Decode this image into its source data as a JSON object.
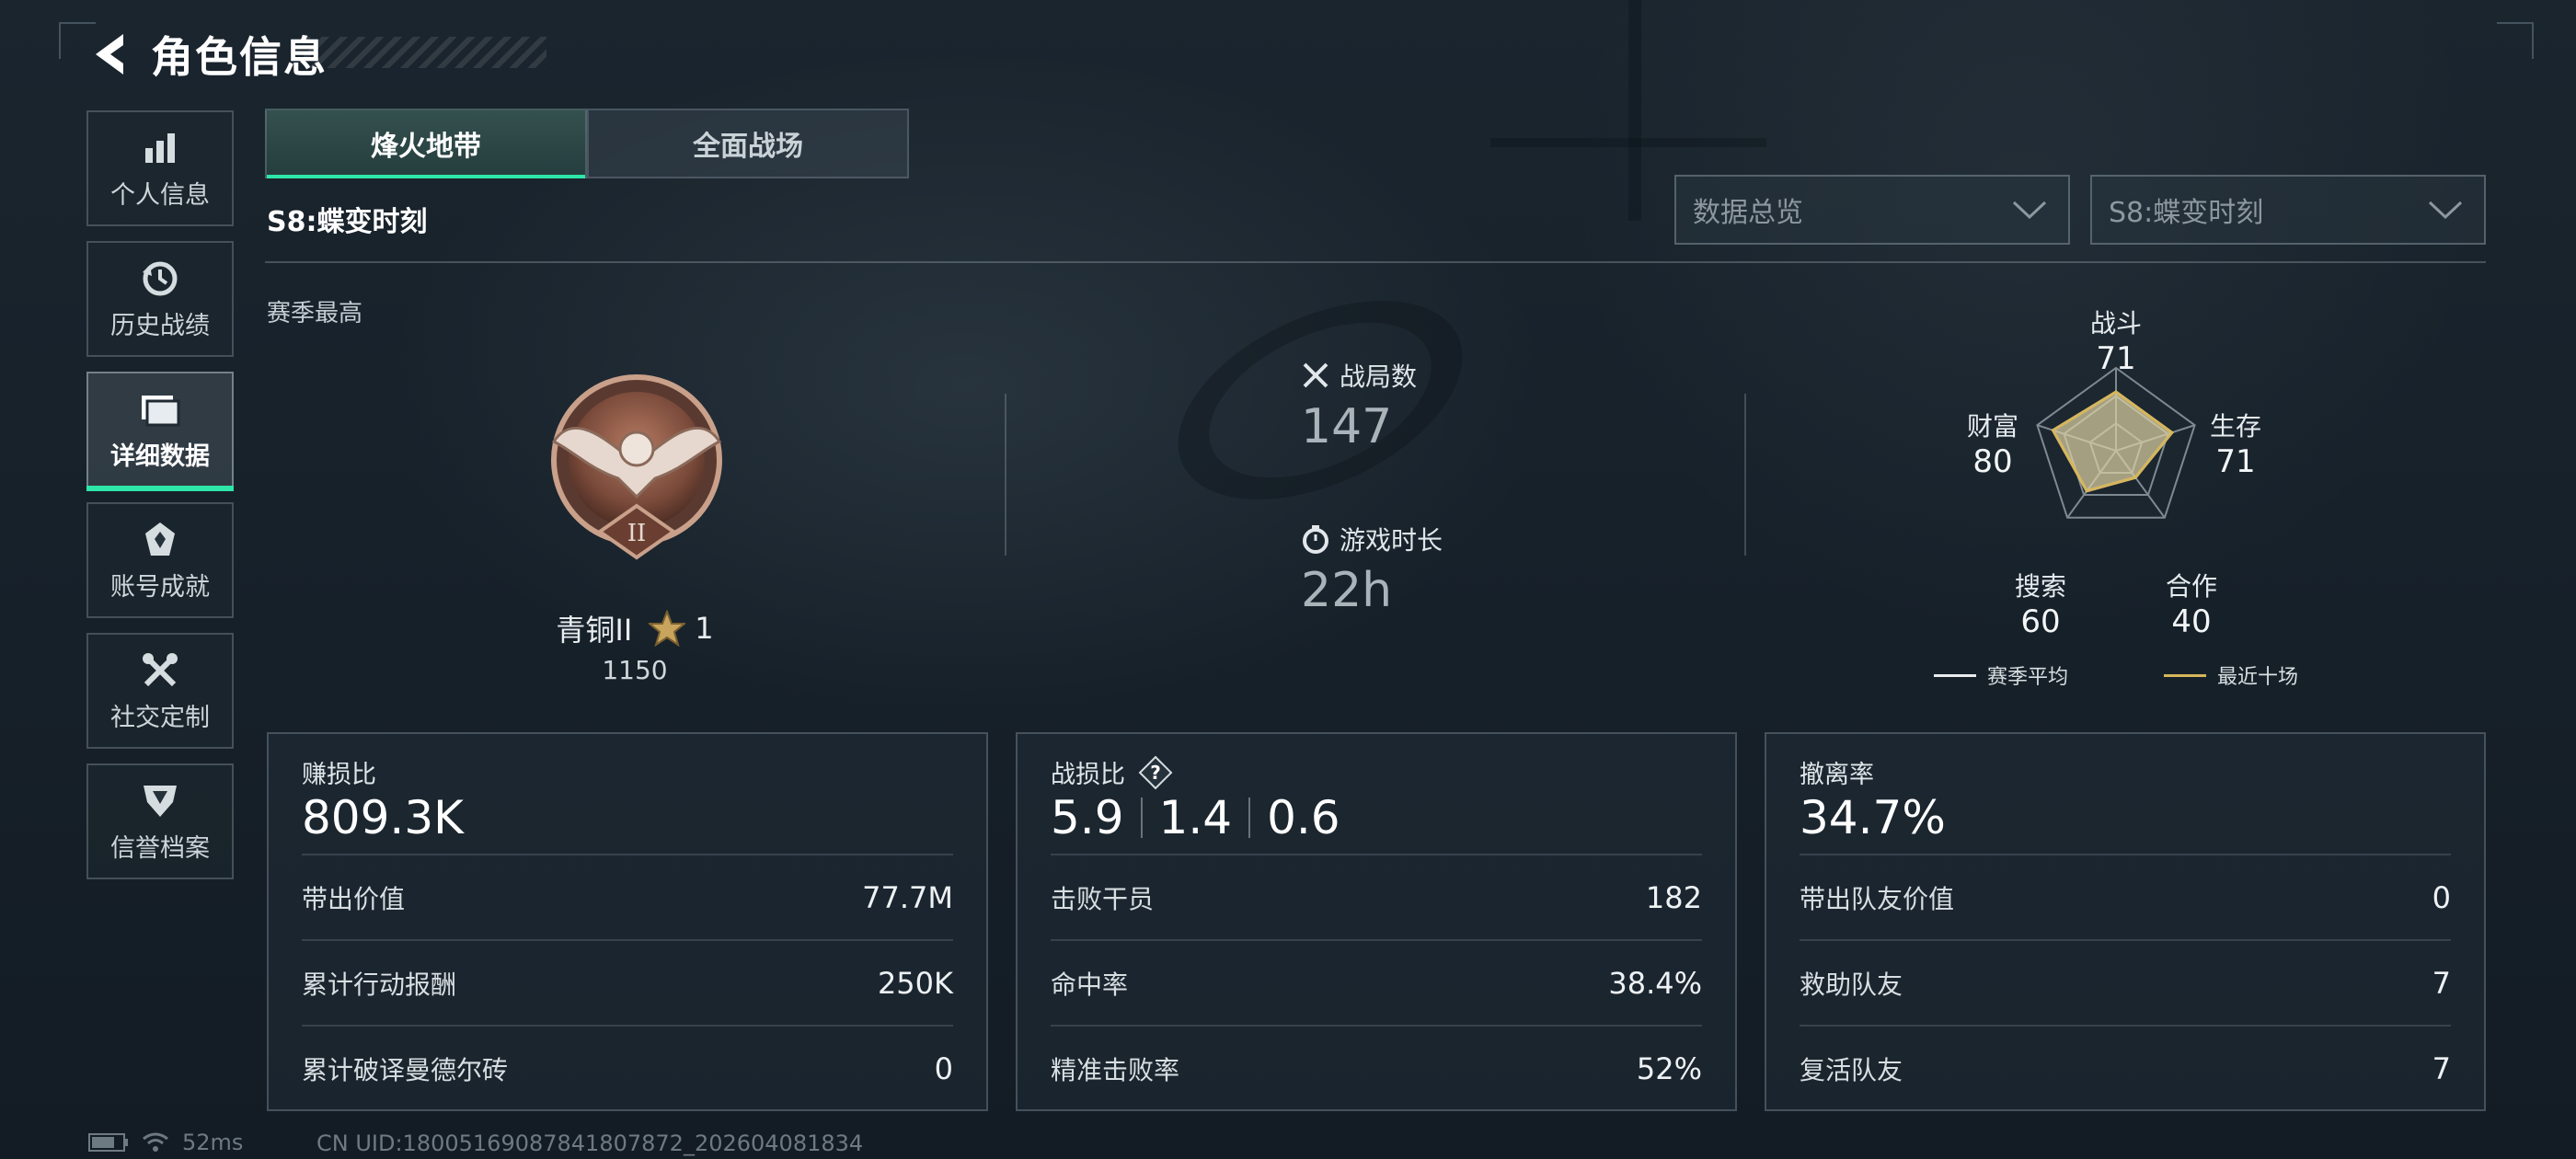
{
  "header": {
    "title": "角色信息"
  },
  "sidebar": {
    "items": [
      {
        "label": "个人信息",
        "icon": "bar-chart-icon"
      },
      {
        "label": "历史战绩",
        "icon": "history-icon"
      },
      {
        "label": "详细数据",
        "icon": "folder-icon"
      },
      {
        "label": "账号成就",
        "icon": "achievement-icon"
      },
      {
        "label": "社交定制",
        "icon": "tools-icon"
      },
      {
        "label": "信誉档案",
        "icon": "credit-shield-icon"
      }
    ],
    "active_index": 2
  },
  "tabs": [
    {
      "label": "烽火地带"
    },
    {
      "label": "全面战场"
    }
  ],
  "season_name": "S8:蝶变时刻",
  "filters": {
    "data_select": "数据总览",
    "season_select": "S8:蝶变时刻"
  },
  "season_best": {
    "label": "赛季最高",
    "rank_name": "青铜II",
    "stars": "1",
    "score": "1150",
    "emblem_numeral": "II"
  },
  "center_stats": {
    "matches_label": "战局数",
    "matches_value": "147",
    "playtime_label": "游戏时长",
    "playtime_value": "22h"
  },
  "radar": {
    "axes": [
      {
        "label": "战斗",
        "value": "71",
        "season_avg": 71,
        "recent": 71
      },
      {
        "label": "生存",
        "value": "71",
        "season_avg": 71,
        "recent": 71
      },
      {
        "label": "合作",
        "value": "40",
        "season_avg": 40,
        "recent": 40
      },
      {
        "label": "搜索",
        "value": "60",
        "season_avg": 60,
        "recent": 60
      },
      {
        "label": "财富",
        "value": "80",
        "season_avg": 80,
        "recent": 80
      }
    ],
    "legend_season": "赛季平均",
    "legend_recent": "最近十场",
    "colors": {
      "season": "#e8ecef",
      "recent": "#d6b65a"
    }
  },
  "panels": {
    "profit": {
      "title": "赚损比",
      "big": "809.3K",
      "rows": [
        {
          "label": "带出价值",
          "value": "77.7M"
        },
        {
          "label": "累计行动报酬",
          "value": "250K"
        },
        {
          "label": "累计破译曼德尔砖",
          "value": "0"
        }
      ]
    },
    "combat": {
      "title": "战损比",
      "big": [
        "5.9",
        "1.4",
        "0.6"
      ],
      "rows": [
        {
          "label": "击败干员",
          "value": "182"
        },
        {
          "label": "命中率",
          "value": "38.4%"
        },
        {
          "label": "精准击败率",
          "value": "52%"
        }
      ]
    },
    "extract": {
      "title": "撤离率",
      "big": "34.7%",
      "rows": [
        {
          "label": "带出队友价值",
          "value": "0"
        },
        {
          "label": "救助队友",
          "value": "7"
        },
        {
          "label": "复活队友",
          "value": "7"
        }
      ]
    }
  },
  "status": {
    "ping": "52ms",
    "uid": "CN UID:18005169087841807872_202604081834"
  },
  "colors": {
    "accent": "#2ee6a8"
  }
}
